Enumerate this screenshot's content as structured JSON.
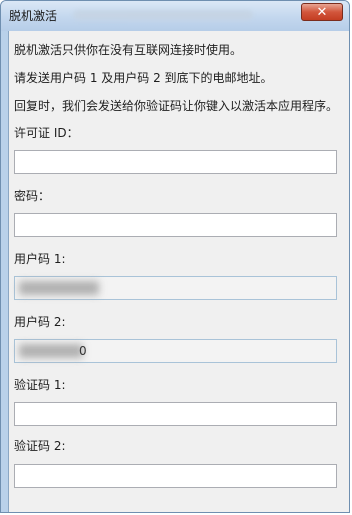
{
  "window": {
    "title": "脱机激活",
    "close_glyph": "✕"
  },
  "intro": {
    "line1": "脱机激活只供你在没有互联网连接时使用。",
    "line2": "请发送用户码 1 及用户码 2 到底下的电邮地址。",
    "line3": "回复时，我们会发送给你验证码让你键入以激活本应用程序。"
  },
  "fields": {
    "license_id": {
      "label": "许可证 ID：",
      "value": ""
    },
    "password": {
      "label": "密码：",
      "value": ""
    },
    "user_code_1": {
      "label": "用户码 1:",
      "value": ""
    },
    "user_code_2": {
      "label": "用户码 2:",
      "value": "0"
    },
    "verify_code_1": {
      "label": "验证码 1:",
      "value": ""
    },
    "verify_code_2": {
      "label": "验证码 2:",
      "value": ""
    }
  }
}
